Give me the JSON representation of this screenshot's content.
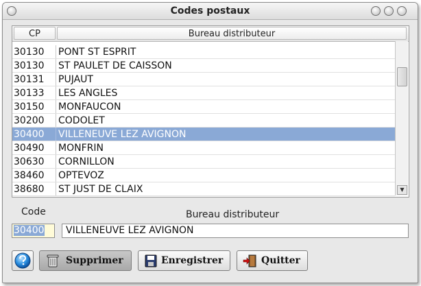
{
  "window": {
    "title": "Codes postaux"
  },
  "table": {
    "columns": [
      "CP",
      "Bureau distributeur"
    ],
    "rows": [
      {
        "cp": "30130",
        "name": "PONT ST ESPRIT",
        "selected": false
      },
      {
        "cp": "30130",
        "name": "ST PAULET DE CAISSON",
        "selected": false
      },
      {
        "cp": "30131",
        "name": "PUJAUT",
        "selected": false
      },
      {
        "cp": "30133",
        "name": "LES ANGLES",
        "selected": false
      },
      {
        "cp": "30150",
        "name": "MONFAUCON",
        "selected": false
      },
      {
        "cp": "30200",
        "name": "CODOLET",
        "selected": false
      },
      {
        "cp": "30400",
        "name": "VILLENEUVE LEZ AVIGNON",
        "selected": true
      },
      {
        "cp": "30490",
        "name": "MONFRIN",
        "selected": false
      },
      {
        "cp": "30630",
        "name": "CORNILLON",
        "selected": false
      },
      {
        "cp": "38460",
        "name": "OPTEVOZ",
        "selected": false
      },
      {
        "cp": "38680",
        "name": "ST JUST DE CLAIX",
        "selected": false
      }
    ]
  },
  "form": {
    "code_label": "Code",
    "bureau_label": "Bureau distributeur",
    "code_value": "30400",
    "bureau_value": "VILLENEUVE LEZ AVIGNON"
  },
  "buttons": {
    "help_icon": "help-icon",
    "delete_label": "Supprimer",
    "save_label": "Enregistrer",
    "quit_label": "Quitter"
  },
  "colors": {
    "selection": "#8aa9d6",
    "code_field_bg": "#fffbd8"
  }
}
